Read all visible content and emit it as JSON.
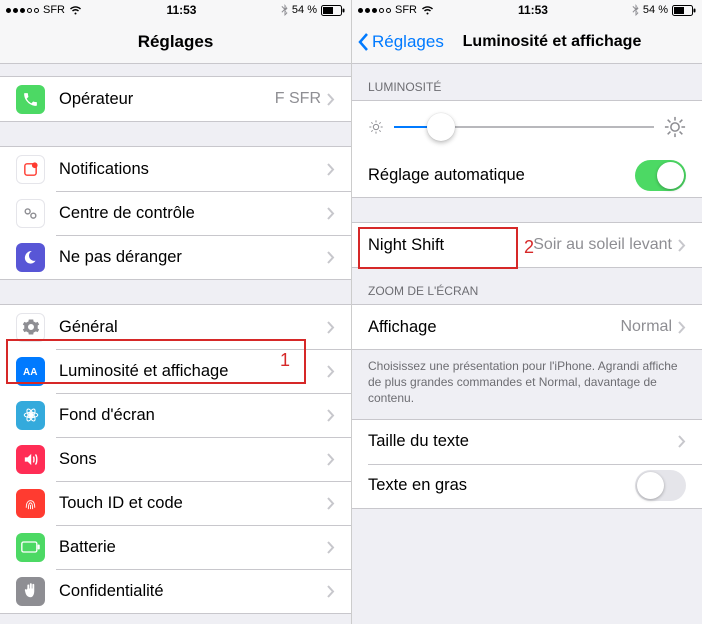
{
  "status": {
    "carrier": "SFR",
    "time": "11:53",
    "battery": "54 %"
  },
  "left": {
    "title": "Réglages",
    "items": {
      "carrier": {
        "label": "Opérateur",
        "detail": "F SFR"
      },
      "notifications": {
        "label": "Notifications"
      },
      "control_center": {
        "label": "Centre de contrôle"
      },
      "dnd": {
        "label": "Ne pas déranger"
      },
      "general": {
        "label": "Général"
      },
      "display": {
        "label": "Luminosité et affichage"
      },
      "wallpaper": {
        "label": "Fond d'écran"
      },
      "sound": {
        "label": "Sons"
      },
      "touchid": {
        "label": "Touch ID et code"
      },
      "battery": {
        "label": "Batterie"
      },
      "privacy": {
        "label": "Confidentialité"
      }
    }
  },
  "right": {
    "back": "Réglages",
    "title": "Luminosité et affichage",
    "headers": {
      "brightness": "LUMINOSITÉ",
      "zoom": "ZOOM DE L'ÉCRAN"
    },
    "rows": {
      "auto": {
        "label": "Réglage automatique"
      },
      "night_shift": {
        "label": "Night Shift",
        "detail": "Soir au soleil levant"
      },
      "display_mode": {
        "label": "Affichage",
        "detail": "Normal"
      },
      "text_size": {
        "label": "Taille du texte"
      },
      "bold_text": {
        "label": "Texte en gras"
      }
    },
    "zoom_footer": "Choisissez une présentation pour l'iPhone. Agrandi affiche de plus grandes commandes et Normal, davantage de contenu.",
    "slider_pct": 18
  },
  "annotations": {
    "one": "1",
    "two": "2"
  }
}
